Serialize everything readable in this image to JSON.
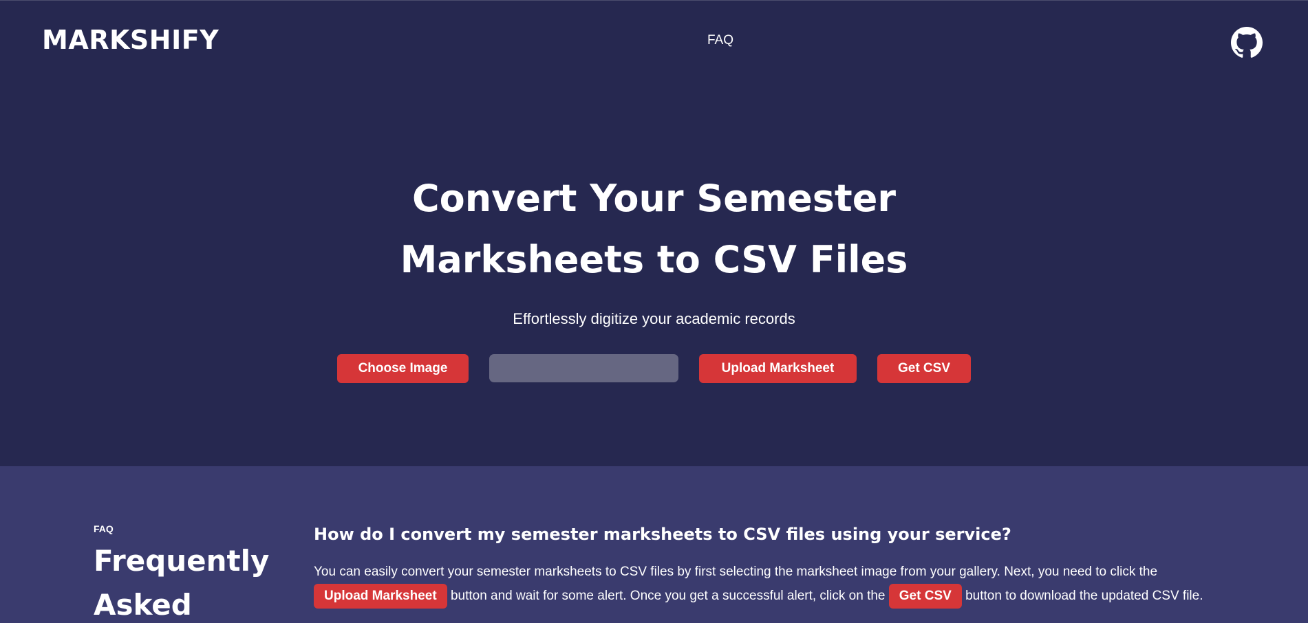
{
  "header": {
    "logo": "MARKSHIFY",
    "nav_faq": "FAQ",
    "github_icon": "github-icon"
  },
  "hero": {
    "title_line1": "Convert Your Semester",
    "title_line2": "Marksheets to CSV Files",
    "subtitle": "Effortlessly digitize your academic records",
    "choose_image_label": "Choose Image",
    "file_field_value": "",
    "upload_label": "Upload Marksheet",
    "get_csv_label": "Get CSV"
  },
  "faq": {
    "kicker": "FAQ",
    "heading_line1": "Frequently",
    "heading_line2": "Asked",
    "question": "How do I convert my semester marksheets to CSV files using your service?",
    "answer_part1": "You can easily convert your semester marksheets to CSV files by first selecting the marksheet image from your gallery. Next, you need to click the",
    "answer_upload_label": "Upload Marksheet",
    "answer_part2": "button and wait for some alert. Once you get a successful alert, click on the",
    "answer_csv_label": "Get CSV",
    "answer_part3": "button to download the updated CSV file."
  },
  "colors": {
    "hero_bg": "#262850",
    "faq_bg": "#3a3b6e",
    "accent": "#d63638",
    "input_bg": "#666782"
  }
}
